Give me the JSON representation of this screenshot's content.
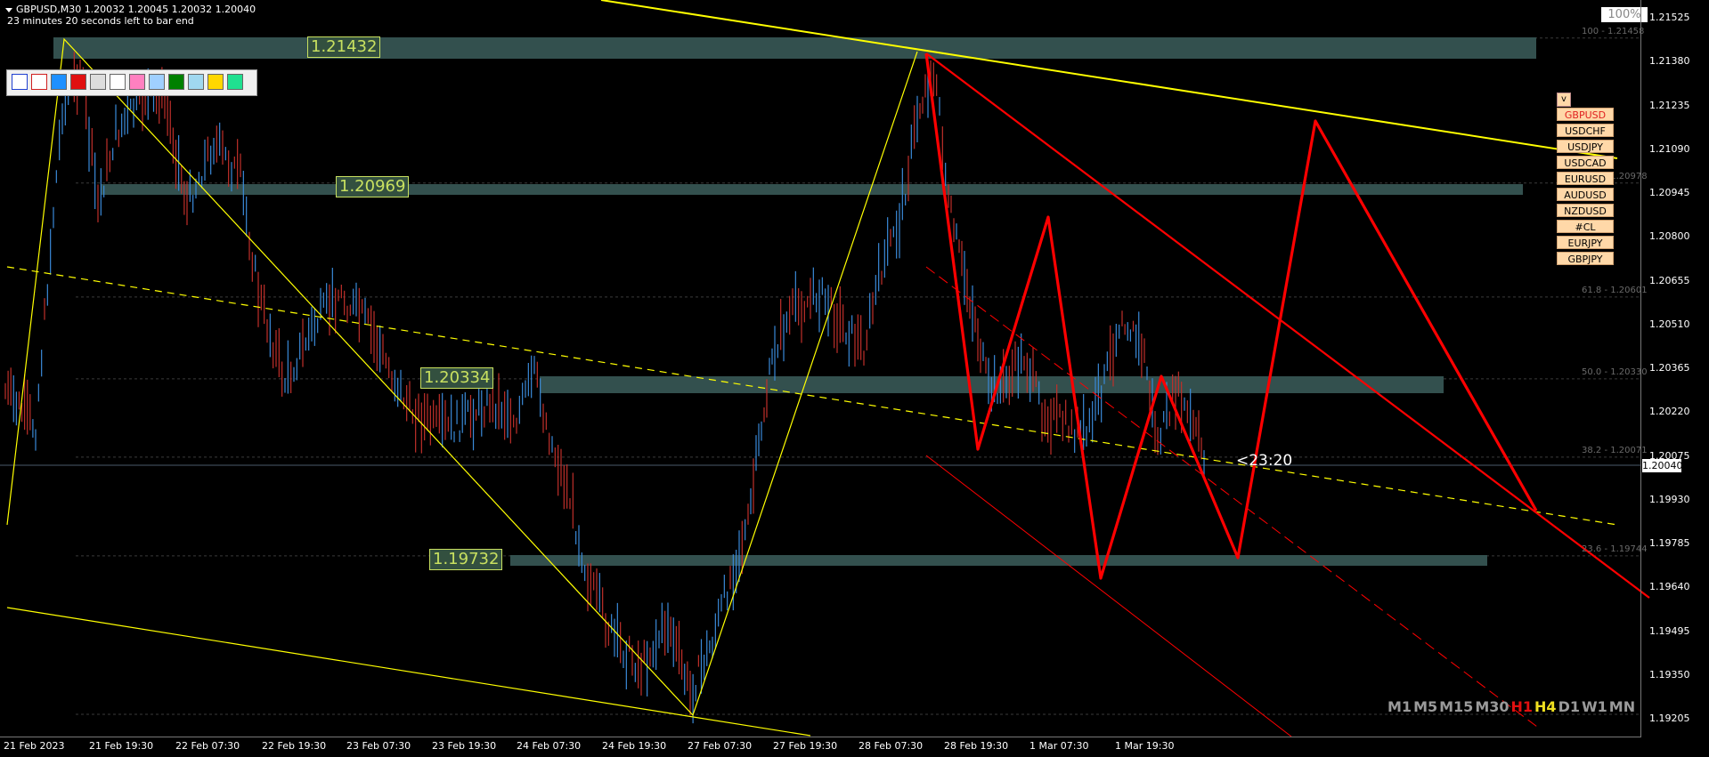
{
  "header": {
    "symbol_line": "GBPUSD,M30  1.20032 1.20045 1.20032 1.20040",
    "timer_line": "23 minutes 20 seconds left to bar end"
  },
  "zoom_label": "100%",
  "price_axis": [
    "1.21525",
    "1.21380",
    "1.21235",
    "1.21090",
    "1.20945",
    "1.20800",
    "1.20655",
    "1.20510",
    "1.20365",
    "1.20220",
    "1.20075",
    "1.19930",
    "1.19785",
    "1.19640",
    "1.19495",
    "1.19350",
    "1.19205"
  ],
  "current_price": "1.20040",
  "time_axis": [
    "21 Feb 2023",
    "21 Feb 19:30",
    "22 Feb 07:30",
    "22 Feb 19:30",
    "23 Feb 07:30",
    "23 Feb 19:30",
    "24 Feb 07:30",
    "24 Feb 19:30",
    "27 Feb 07:30",
    "27 Feb 19:30",
    "28 Feb 07:30",
    "28 Feb 19:30",
    "1 Mar 07:30",
    "1 Mar 19:30"
  ],
  "levels": [
    "1.21432",
    "1.20969",
    "1.20334",
    "1.19732"
  ],
  "fib_labels": [
    "100 - 1.21458",
    "76.4 - 1.20978",
    "61.8 - 1.20601",
    "50.0 - 1.20330",
    "38.2 - 1.20071",
    "23.6 - 1.19744"
  ],
  "countdown": "<23:20",
  "symbols": {
    "header": "v",
    "items": [
      "GBPUSD",
      "USDCHF",
      "USDJPY",
      "USDCAD",
      "EURUSD",
      "AUDUSD",
      "NZDUSD",
      "#CL",
      "EURJPY",
      "GBPJPY"
    ]
  },
  "timeframes": [
    {
      "label": "M1",
      "color": "#9a9a9a"
    },
    {
      "label": "M5",
      "color": "#9a9a9a"
    },
    {
      "label": "M15",
      "color": "#9a9a9a"
    },
    {
      "label": "M30",
      "color": "#9a9a9a"
    },
    {
      "label": "H1",
      "color": "#e01010"
    },
    {
      "label": "H4",
      "color": "#f0e020"
    },
    {
      "label": "D1",
      "color": "#9a9a9a"
    },
    {
      "label": "W1",
      "color": "#9a9a9a"
    },
    {
      "label": "MN",
      "color": "#9a9a9a"
    }
  ],
  "toolbar_colors": [
    "#ffffff",
    "#ffffff",
    "#1e90ff",
    "#e01010",
    "#dddddd",
    "#ffffff",
    "#ff80c0",
    "#a0d0ff",
    "#008000",
    "#a0d8f0",
    "#ffd700",
    "#20e090"
  ],
  "colors": {
    "background": "#000000",
    "bull_candle": "#3a8ad8",
    "bear_candle": "#c0302a",
    "zone": "#33504e",
    "channel": "#ffff00",
    "pattern": "#ff0000"
  }
}
